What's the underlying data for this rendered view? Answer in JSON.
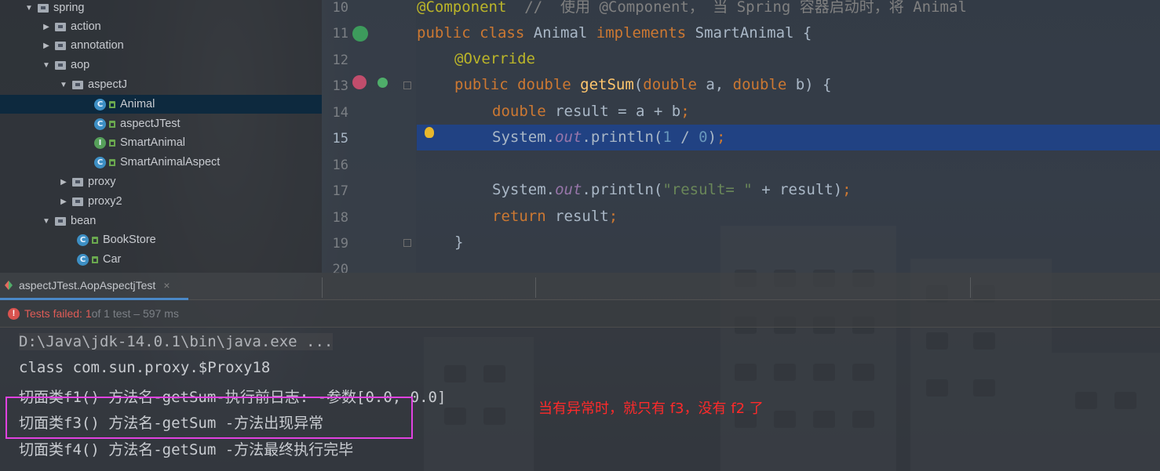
{
  "tree": {
    "items": [
      {
        "label": "spring",
        "kind": "folder",
        "expanded": true
      },
      {
        "label": "action",
        "kind": "folder",
        "expanded": false
      },
      {
        "label": "annotation",
        "kind": "folder",
        "expanded": false
      },
      {
        "label": "aop",
        "kind": "folder",
        "expanded": true
      },
      {
        "label": "aspectJ",
        "kind": "folder",
        "expanded": true
      },
      {
        "label": "Animal",
        "kind": "class",
        "badge": "C",
        "selected": true
      },
      {
        "label": "aspectJTest",
        "kind": "class",
        "badge": "C"
      },
      {
        "label": "SmartAnimal",
        "kind": "interface",
        "badge": "I"
      },
      {
        "label": "SmartAnimalAspect",
        "kind": "class",
        "badge": "C"
      },
      {
        "label": "proxy",
        "kind": "folder",
        "expanded": false
      },
      {
        "label": "proxy2",
        "kind": "folder",
        "expanded": false
      },
      {
        "label": "bean",
        "kind": "folder",
        "expanded": true
      },
      {
        "label": "BookStore",
        "kind": "class",
        "badge": "C"
      },
      {
        "label": "Car",
        "kind": "class",
        "badge": "C"
      }
    ]
  },
  "editor": {
    "line_numbers": [
      "10",
      "11",
      "12",
      "13",
      "14",
      "15",
      "16",
      "17",
      "18",
      "19",
      "20"
    ],
    "current_line": "15",
    "code": {
      "l10_ann": "@Component",
      "l10_cmt": "  //  使用 @Component， 当 Spring 容器启动时，将 Animal",
      "l11_kw1": "public class ",
      "l11_name": "Animal ",
      "l11_kw2": "implements ",
      "l11_rest": "SmartAnimal {",
      "l12_ann": "@Override",
      "l13_kw": "public double ",
      "l13_fn": "getSum",
      "l13_p1": "(",
      "l13_kw2": "double ",
      "l13_p2": "a, ",
      "l13_kw3": "double ",
      "l13_p3": "b) {",
      "l14_kw": "double ",
      "l14_rest": "result = a + b",
      "l14_semi": ";",
      "l15_a": "System.",
      "l15_out": "out",
      "l15_b": ".println(",
      "l15_n1": "1",
      "l15_c": " / ",
      "l15_n2": "0",
      "l15_d": ")",
      "l15_semi": ";",
      "l17_a": "System.",
      "l17_out": "out",
      "l17_b": ".println(",
      "l17_str": "\"result= \"",
      "l17_c": " + result)",
      "l17_semi": ";",
      "l18_kw": "return ",
      "l18_rest": "result",
      "l18_semi": ";",
      "l19": "}"
    }
  },
  "run": {
    "tab_label": "aspectJTest.AopAspectjTest",
    "close_glyph": "×",
    "status_failed": "Tests failed: 1",
    "status_rest": " of 1 test – 597 ms"
  },
  "console": {
    "lines": [
      "D:\\Java\\jdk-14.0.1\\bin\\java.exe ...",
      "class com.sun.proxy.$Proxy18",
      "切面类f1() 方法名-getSum-执行前日志: -参数[0.0, 0.0]",
      "切面类f3() 方法名-getSum -方法出现异常",
      "切面类f4() 方法名-getSum -方法最终执行完毕"
    ],
    "annotation": "当有异常时，就只有 f3，没有 f2 了"
  },
  "colors": {
    "selection": "#214283",
    "keyword": "#cc7832",
    "annotation": "#bbb529",
    "highlight_box": "#e042e0",
    "note": "#ff2a2a"
  }
}
